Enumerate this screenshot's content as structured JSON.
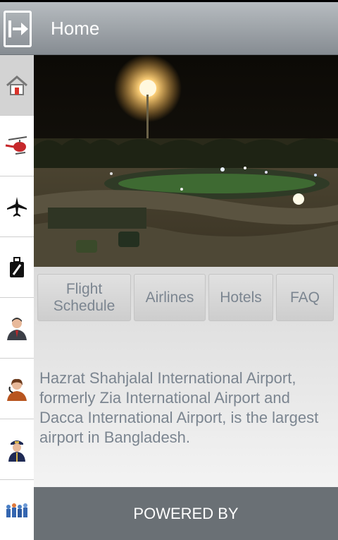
{
  "header": {
    "title": "Home",
    "back_icon": "exit-arrow-icon"
  },
  "sidebar": {
    "items": [
      {
        "icon": "home-icon",
        "active": true
      },
      {
        "icon": "helicopter-icon"
      },
      {
        "icon": "airplane-icon"
      },
      {
        "icon": "luggage-icon"
      },
      {
        "icon": "businessman-icon"
      },
      {
        "icon": "receptionist-icon"
      },
      {
        "icon": "pilot-icon"
      },
      {
        "icon": "crowd-icon"
      }
    ]
  },
  "hero": {
    "image": "airport night photo"
  },
  "tabs": [
    {
      "label": "Flight Schedule"
    },
    {
      "label": "Airlines"
    },
    {
      "label": "Hotels"
    },
    {
      "label": "FAQ"
    }
  ],
  "description": "Hazrat Shahjalal International Airport, formerly Zia International Airport and Dacca International Airport, is the largest airport in Bangladesh.",
  "footer": {
    "text": "POWERED BY"
  },
  "colors": {
    "header": "#9ea4a9",
    "footer": "#6a7075",
    "text": "#7b8590"
  }
}
